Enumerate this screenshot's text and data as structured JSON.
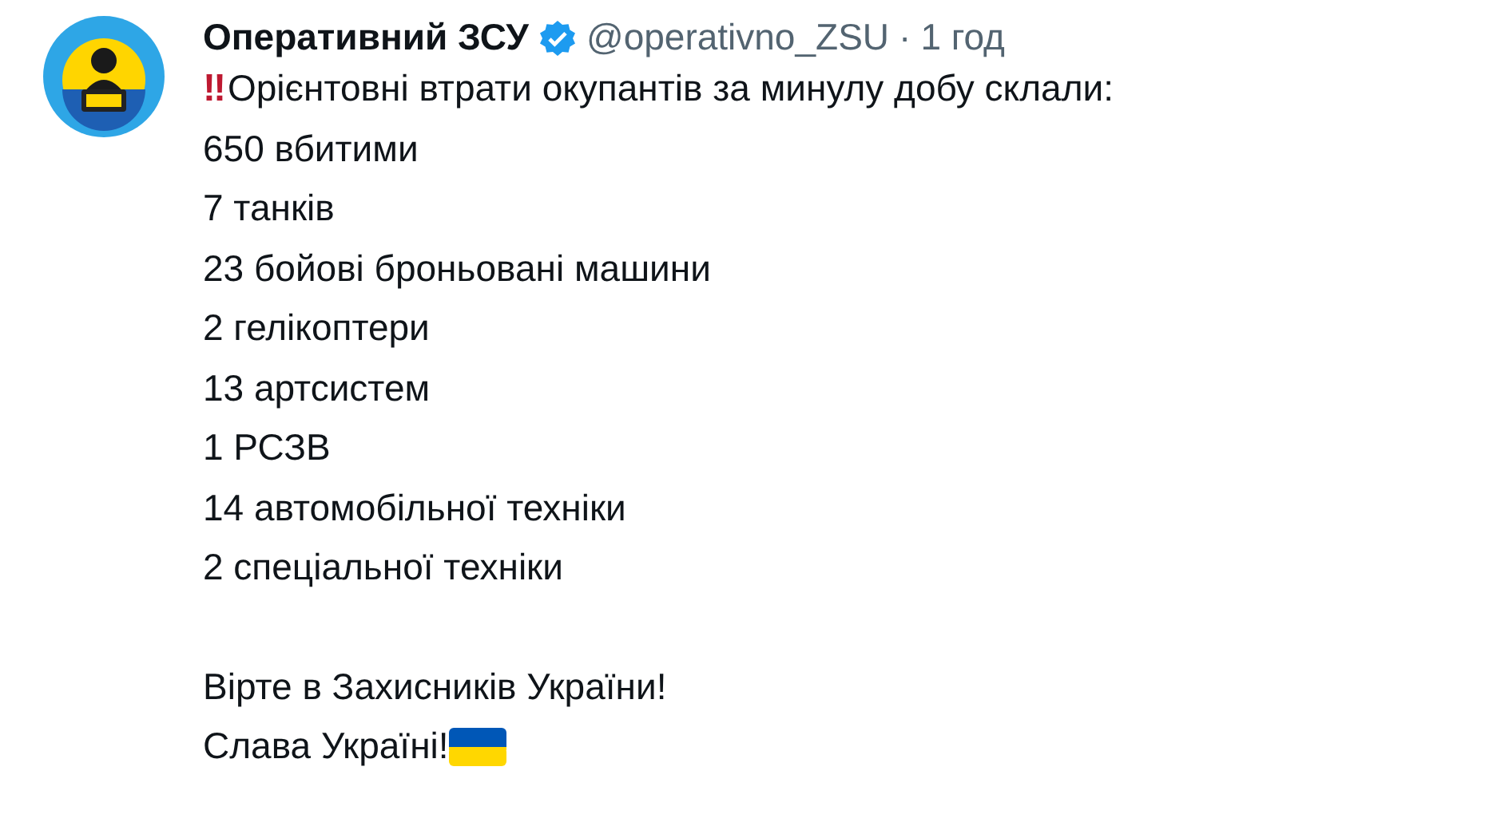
{
  "author": {
    "name": "Оперативний ЗСУ",
    "verified": true,
    "handle": "@operativno_ZSU",
    "separator": "·",
    "time": "1 год"
  },
  "tweet": {
    "lead_emoji": "‼",
    "paragraphs": [
      [
        "Орієнтовні втрати окупантів за минулу добу склали:",
        "650 вбитими",
        "7 танків",
        "23 бойові броньовані машини",
        "2 гелікоптери",
        "13 артсистем",
        "1 РСЗВ",
        "14 автомобільної техніки",
        "2 спеціальної техніки"
      ],
      [
        "Вірте в Захисників України!",
        "Слава Україні!"
      ]
    ],
    "trailing_flag": true
  }
}
